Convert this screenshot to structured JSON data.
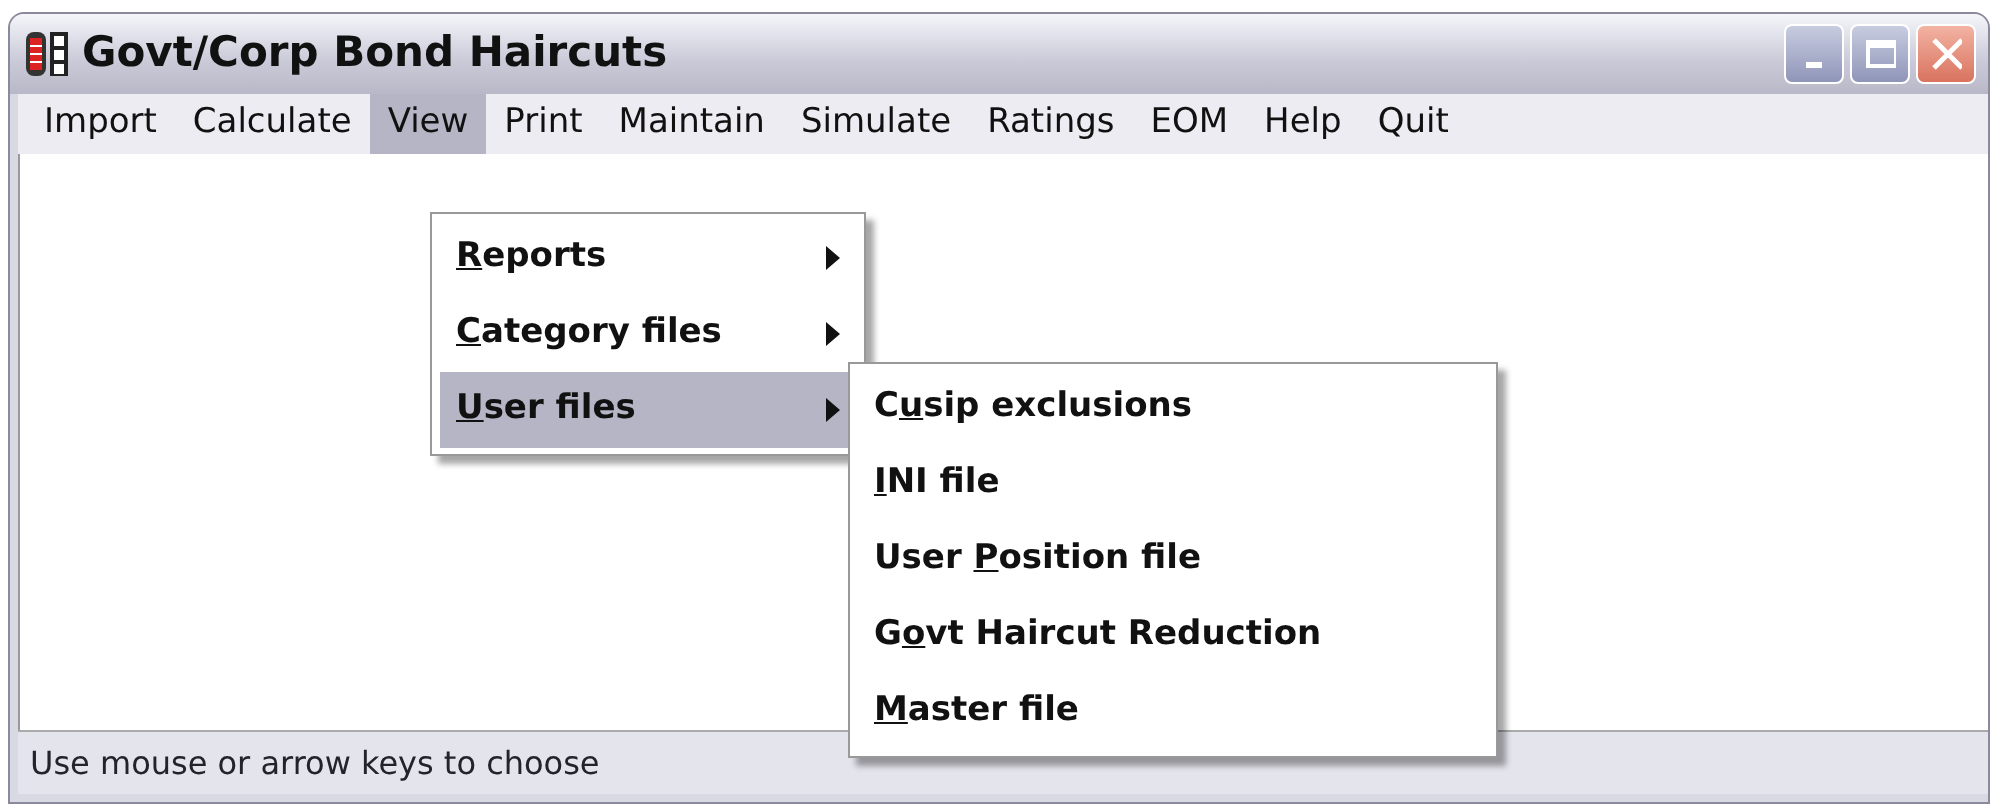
{
  "window": {
    "title": "Govt/Corp Bond Haircuts"
  },
  "menu_bar": [
    {
      "label": "Import",
      "selected": false
    },
    {
      "label": "Calculate",
      "selected": false
    },
    {
      "label": "View",
      "selected": true
    },
    {
      "label": "Print",
      "selected": false
    },
    {
      "label": "Maintain",
      "selected": false
    },
    {
      "label": "Simulate",
      "selected": false
    },
    {
      "label": "Ratings",
      "selected": false
    },
    {
      "label": "EOM",
      "selected": false
    },
    {
      "label": "Help",
      "selected": false
    },
    {
      "label": "Quit",
      "selected": false
    }
  ],
  "view_menu": [
    {
      "accel": "R",
      "after": "eports",
      "submenu": true,
      "selected": false
    },
    {
      "accel": "C",
      "after": "ategory files",
      "submenu": true,
      "selected": false
    },
    {
      "accel": "U",
      "after": "ser files",
      "submenu": true,
      "selected": true
    }
  ],
  "user_files_menu": [
    {
      "before": "C",
      "accel": "u",
      "after": "sip exclusions",
      "selected": false
    },
    {
      "accel": "I",
      "after": "NI file",
      "selected": false
    },
    {
      "before": "User ",
      "accel": "P",
      "after": "osition file",
      "selected": false
    },
    {
      "before": "G",
      "accel": "o",
      "after": "vt Haircut Reduction",
      "selected": false
    },
    {
      "accel": "M",
      "after": "aster file",
      "selected": false
    }
  ],
  "status_bar": {
    "text": "Use mouse or arrow keys to choose"
  }
}
